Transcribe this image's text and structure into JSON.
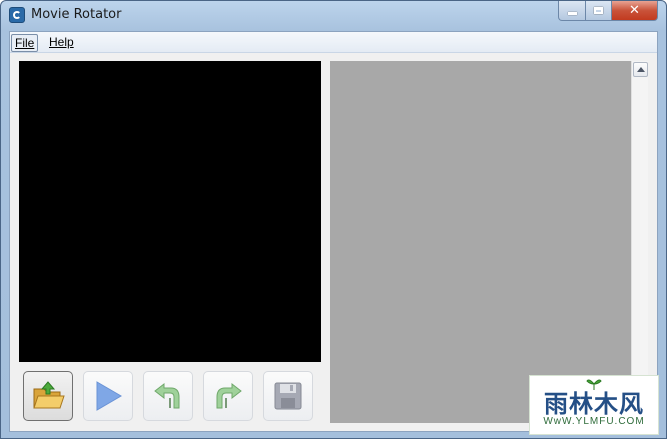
{
  "window": {
    "title": "Movie Rotator",
    "close_glyph": "✕"
  },
  "menu": {
    "file": "File",
    "help": "Help"
  },
  "toolbar": {
    "buttons": [
      {
        "name": "open-button",
        "icon": "open-folder-icon"
      },
      {
        "name": "play-button",
        "icon": "play-icon"
      },
      {
        "name": "rotate-left-button",
        "icon": "rotate-left-icon"
      },
      {
        "name": "rotate-right-button",
        "icon": "rotate-right-icon"
      },
      {
        "name": "save-button",
        "icon": "floppy-disk-icon"
      }
    ]
  },
  "watermark": {
    "main": "雨林木风",
    "sub": "WwW.YLMFU.COM"
  },
  "colors": {
    "preview_bg": "#000000",
    "thumbnail_bg": "#a8a8a8",
    "close_red": "#c23a1f"
  }
}
